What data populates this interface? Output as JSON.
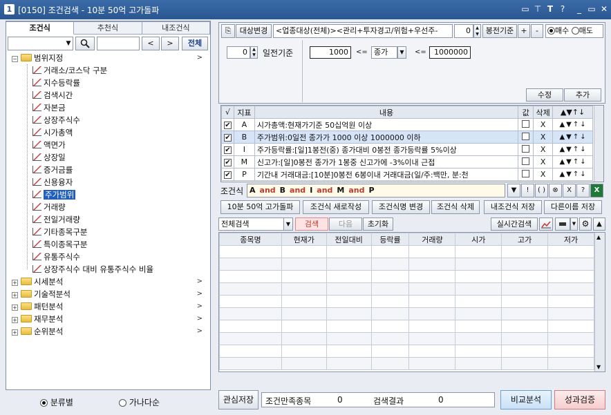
{
  "window": {
    "number": "1",
    "title": "[0150] 조건검색 - 10분 50억 고가돌파",
    "controls": [
      "▭",
      "⊤",
      "T",
      "?",
      "_",
      "▭",
      "✕"
    ]
  },
  "left": {
    "tabs": [
      "조건식",
      "추천식",
      "내조건식"
    ],
    "search_value": "",
    "search_value2": "",
    "prev": "<",
    "next": ">",
    "all_button": "전체",
    "tree": [
      {
        "label": "범위지정",
        "type": "folder",
        "expanded": true,
        "depth": 0,
        "arrow": ">"
      },
      {
        "label": "거래소/코스닥 구분",
        "type": "item",
        "depth": 1
      },
      {
        "label": "지수등락률",
        "type": "item",
        "depth": 1
      },
      {
        "label": "검색시간",
        "type": "item",
        "depth": 1
      },
      {
        "label": "자본금",
        "type": "item",
        "depth": 1
      },
      {
        "label": "상장주식수",
        "type": "item",
        "depth": 1
      },
      {
        "label": "시가총액",
        "type": "item",
        "depth": 1
      },
      {
        "label": "액면가",
        "type": "item",
        "depth": 1
      },
      {
        "label": "상장일",
        "type": "item",
        "depth": 1
      },
      {
        "label": "증거금률",
        "type": "item",
        "depth": 1
      },
      {
        "label": "신용융자",
        "type": "item",
        "depth": 1
      },
      {
        "label": "주가범위",
        "type": "item",
        "depth": 1,
        "selected": true
      },
      {
        "label": "거래량",
        "type": "item",
        "depth": 1
      },
      {
        "label": "전일거래량",
        "type": "item",
        "depth": 1
      },
      {
        "label": "기타종목구분",
        "type": "item",
        "depth": 1
      },
      {
        "label": "특이종목구분",
        "type": "item",
        "depth": 1
      },
      {
        "label": "유통주식수",
        "type": "item",
        "depth": 1
      },
      {
        "label": "상장주식수 대비 유통주식수 비율",
        "type": "item",
        "depth": 1
      },
      {
        "label": "시세분석",
        "type": "folder",
        "expanded": false,
        "depth": 0,
        "arrow": ">"
      },
      {
        "label": "기술적분석",
        "type": "folder",
        "expanded": false,
        "depth": 0,
        "arrow": ">"
      },
      {
        "label": "패턴분석",
        "type": "folder",
        "expanded": false,
        "depth": 0,
        "arrow": ">"
      },
      {
        "label": "재무분석",
        "type": "folder",
        "expanded": false,
        "depth": 0,
        "arrow": ">"
      },
      {
        "label": "순위분석",
        "type": "folder",
        "expanded": false,
        "depth": 0,
        "arrow": ">"
      }
    ],
    "radio": {
      "opt1": "분류별",
      "opt2": "가나다순",
      "selected": "opt1"
    }
  },
  "top": {
    "target_change": "대상변경",
    "target_desc": "<업종대상(전체)><관리+투자경고/위험+우선주-",
    "bong_value": "0",
    "bong_label": "봉전기준",
    "plus": "+",
    "minus": "-",
    "buy": "매수",
    "sell": "매도",
    "days_value": "0",
    "days_label": "일전기준",
    "min_value": "1000",
    "lte1": "<=",
    "price_type": "종가",
    "lte2": "<=",
    "max_value": "1000000",
    "edit": "수정",
    "add": "추가"
  },
  "conditions": {
    "headers": {
      "check": "√",
      "index": "지표",
      "content": "내용",
      "value": "값",
      "delete": "삭제"
    },
    "rows": [
      {
        "id": "A",
        "content": "시가총액:현재가기준 50십억원 이상",
        "checked": true,
        "selected": false
      },
      {
        "id": "B",
        "content": "주가범위:0일전 종가가 1000 이상 1000000 이하",
        "checked": true,
        "selected": true
      },
      {
        "id": "I",
        "content": "주가등락률:[일]1봉전(중) 종가대비 0봉전 종가등락률 5%이상",
        "checked": true,
        "selected": false
      },
      {
        "id": "M",
        "content": "신고가:[일]0봉전 종가가 1봉중 신고가에 -3%이내 근접",
        "checked": true,
        "selected": false
      },
      {
        "id": "P",
        "content": "기간내 거래대금:[10분]0봉전 6봉이내 거래대금(일/주:백만, 분:천",
        "checked": true,
        "selected": false
      }
    ],
    "delete_mark": "X",
    "move_arrows": [
      "▲",
      "▼",
      "↑",
      "↓"
    ]
  },
  "formula": {
    "label": "조건식",
    "tokens": [
      {
        "t": "A",
        "kw": false
      },
      {
        "t": "and",
        "kw": true
      },
      {
        "t": "B",
        "kw": false
      },
      {
        "t": "and",
        "kw": true
      },
      {
        "t": "I",
        "kw": false
      },
      {
        "t": "and",
        "kw": true
      },
      {
        "t": "M",
        "kw": false
      },
      {
        "t": "and",
        "kw": true
      },
      {
        "t": "P",
        "kw": false
      }
    ],
    "ops": [
      "▼",
      "!",
      "( )",
      "⊗",
      "X",
      "?",
      "X"
    ]
  },
  "actions": {
    "name": "10분 50억 고가돌파",
    "new": "조건식 새로작성",
    "rename": "조건식명 변경",
    "delete": "조건식 삭제",
    "save_mine": "내조건식 저장",
    "save_as": "다른이름 저장"
  },
  "search": {
    "scope": "전체검색",
    "search": "검색",
    "next": "다음",
    "reset": "초기화",
    "realtime": "실시간검색"
  },
  "results": {
    "headers": [
      "종목명",
      "현재가",
      "전일대비",
      "등락률",
      "거래량",
      "시가",
      "고가",
      "저가"
    ],
    "rows": []
  },
  "status": {
    "watch_save": "관심저장",
    "match_label": "조건만족종목",
    "match_count": "0",
    "result_label": "검색결과",
    "result_count": "0",
    "compare": "비교분석",
    "verify": "성과검증"
  }
}
